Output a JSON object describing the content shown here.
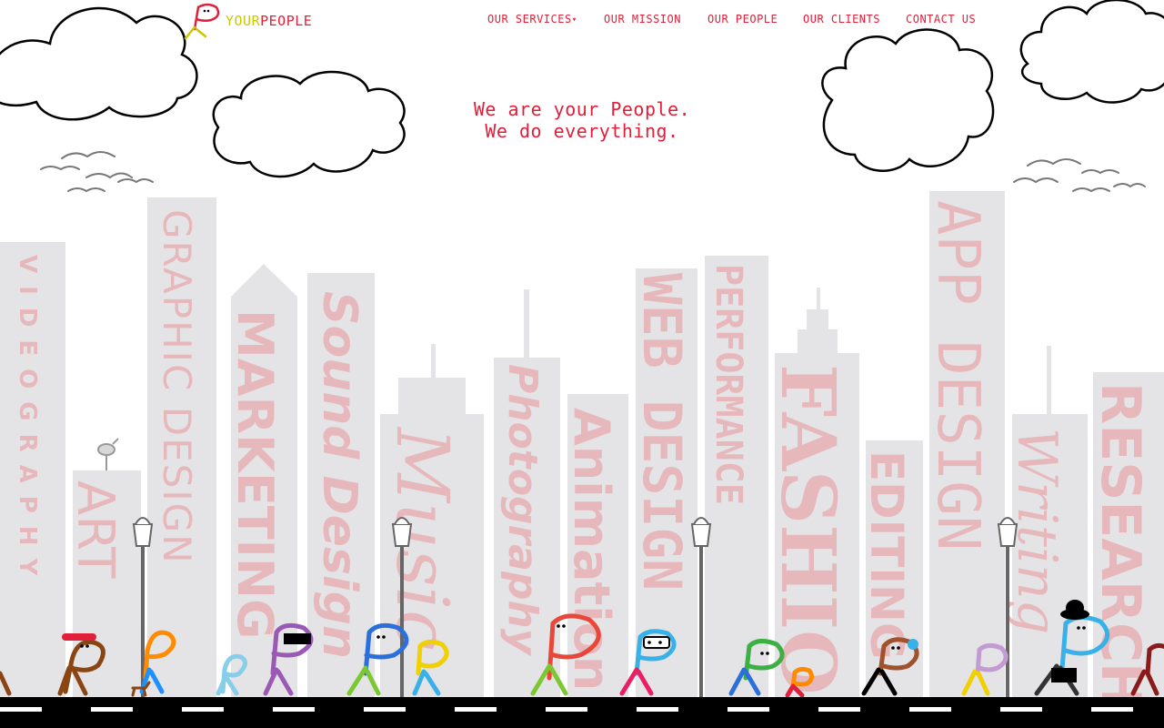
{
  "brand": {
    "part1": "YOUR",
    "part2": "PEOPLE"
  },
  "nav": {
    "services": "OUR SERVICES",
    "mission": "OUR MISSION",
    "people": "OUR PEOPLE",
    "clients": "OUR CLIENTS",
    "contact": "CONTACT US"
  },
  "hero": {
    "line1": "We are your People.",
    "line2": "We do everything."
  },
  "buildings": [
    {
      "label": "VIDEOGRAPHY"
    },
    {
      "label": "GRAPHIC DESIGN"
    },
    {
      "label": "MARKETING"
    },
    {
      "label": "Sound Design"
    },
    {
      "label": "Music"
    },
    {
      "label": "Photography"
    },
    {
      "label": "Animation"
    },
    {
      "label": "WEB DESIGN"
    },
    {
      "label": "PERFORMANCE"
    },
    {
      "label": "FASHION"
    },
    {
      "label": "EDITING"
    },
    {
      "label": "APP DESIGN"
    },
    {
      "label": "Writing"
    },
    {
      "label": "RESEARCH"
    },
    {
      "label": "ART"
    }
  ],
  "colors": {
    "accent_red": "#e0203a",
    "accent_yellow": "#c9c900",
    "building": "#e4e4e6",
    "building_text": "#e6b8bc",
    "road": "#000000"
  }
}
